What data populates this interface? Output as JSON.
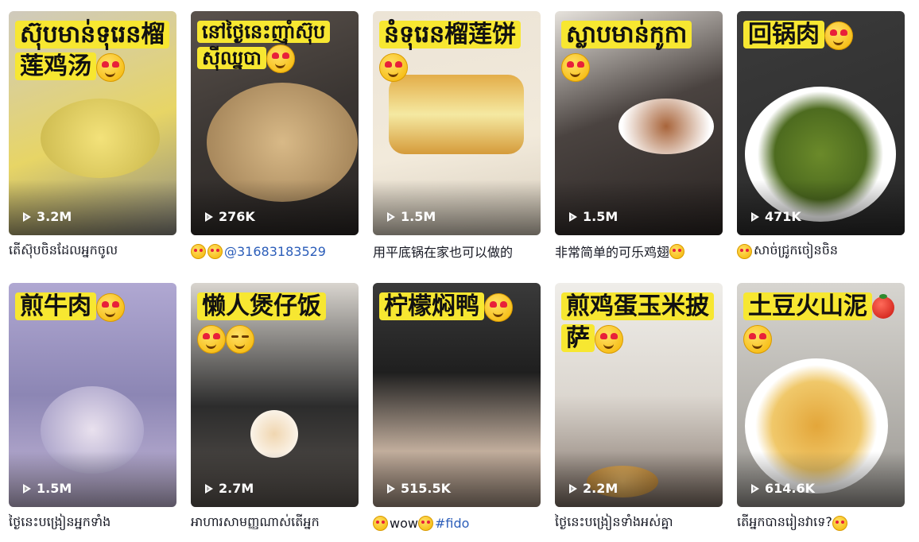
{
  "videos": [
    {
      "overlay": "ស៊ុបមាន់ទុរេន榴莲鸡汤",
      "views": "3.2M",
      "caption": "តើស៊ុបចិនដែលអ្នកចូល",
      "bg": [
        "#b9b7a8",
        "#e9d86a"
      ]
    },
    {
      "overlay": "នៅថ្ងៃនេះញ៉ាំស៊ុបស៊ីឈ្នបា",
      "views": "276K",
      "caption_mention": "@31683183529",
      "bg": [
        "#4a4440",
        "#b89a6a"
      ]
    },
    {
      "overlay": "នំទុរេន榴莲饼",
      "views": "1.5M",
      "caption": "用平底锅在家也可以做的",
      "bg": [
        "#f1e7d2",
        "#d8a64a"
      ]
    },
    {
      "overlay": "ស្លាបមាន់កូកា",
      "views": "1.5M",
      "caption": "非常简单的可乐鸡翅",
      "bg": [
        "#3a3432",
        "#d9c6a8"
      ]
    },
    {
      "overlay": "回锅肉",
      "views": "471K",
      "caption": "សាច់ជ្រូកចៀនចិន",
      "bg": [
        "#2d3a22",
        "#6a8d2f"
      ]
    },
    {
      "overlay": "煎牛肉",
      "views": "1.5M",
      "caption": "ថ្ងៃនេះបង្រៀនអ្នកទាំង",
      "bg": [
        "#6f6a94",
        "#c7b7d6"
      ]
    },
    {
      "overlay": "懒人煲仔饭",
      "views": "2.7M",
      "caption": "អាហារសាមញ្ញណាស់តើអ្នក",
      "bg": [
        "#6a6560",
        "#d8d2c8"
      ]
    },
    {
      "overlay": "柠檬焖鸭",
      "views": "515.5K",
      "caption_text": "wow",
      "caption_tag": "#fido",
      "bg": [
        "#2a2a2a",
        "#b9a99a"
      ]
    },
    {
      "overlay": "煎鸡蛋玉米披萨",
      "views": "2.2M",
      "caption": "ថ្ងៃនេះបង្រៀនទាំងអស់គ្នា",
      "bg": [
        "#e2e0dc",
        "#a49080"
      ]
    },
    {
      "overlay": "土豆火山泥",
      "views": "614.6K",
      "caption": "តើអ្នកបានរៀនវាទេ?",
      "bg": [
        "#d4d2cd",
        "#e8b44a"
      ]
    }
  ]
}
